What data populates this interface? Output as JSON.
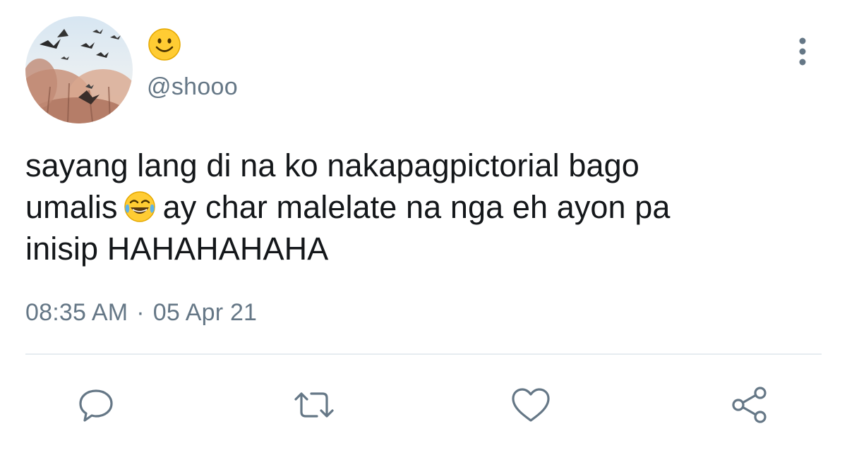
{
  "user": {
    "display_name_icon": "smiling-face-emoji",
    "handle": "@shooo",
    "avatar_description_icon": "birds-over-trees-avatar"
  },
  "tweet": {
    "text_line_1": "sayang lang di na ko nakapagpictorial bago",
    "text_part_2": "umalis",
    "inline_emoji": "tears-of-joy-emoji",
    "text_part_3": "ay char malelate na nga eh ayon pa",
    "text_line_3": "inisip HAHAHAHAHA",
    "time": "08:35 AM",
    "separator": "·",
    "date": "05 Apr 21"
  },
  "actions": {
    "reply_icon": "comment-icon",
    "retweet_icon": "retweet-icon",
    "like_icon": "heart-icon",
    "share_icon": "share-icon",
    "more_icon": "more-vertical-icon"
  },
  "colors": {
    "text": "#14171a",
    "secondary": "#657786",
    "icon": "#657786",
    "divider": "#e6ecf0",
    "emoji_yellow": "#ffcc33"
  }
}
